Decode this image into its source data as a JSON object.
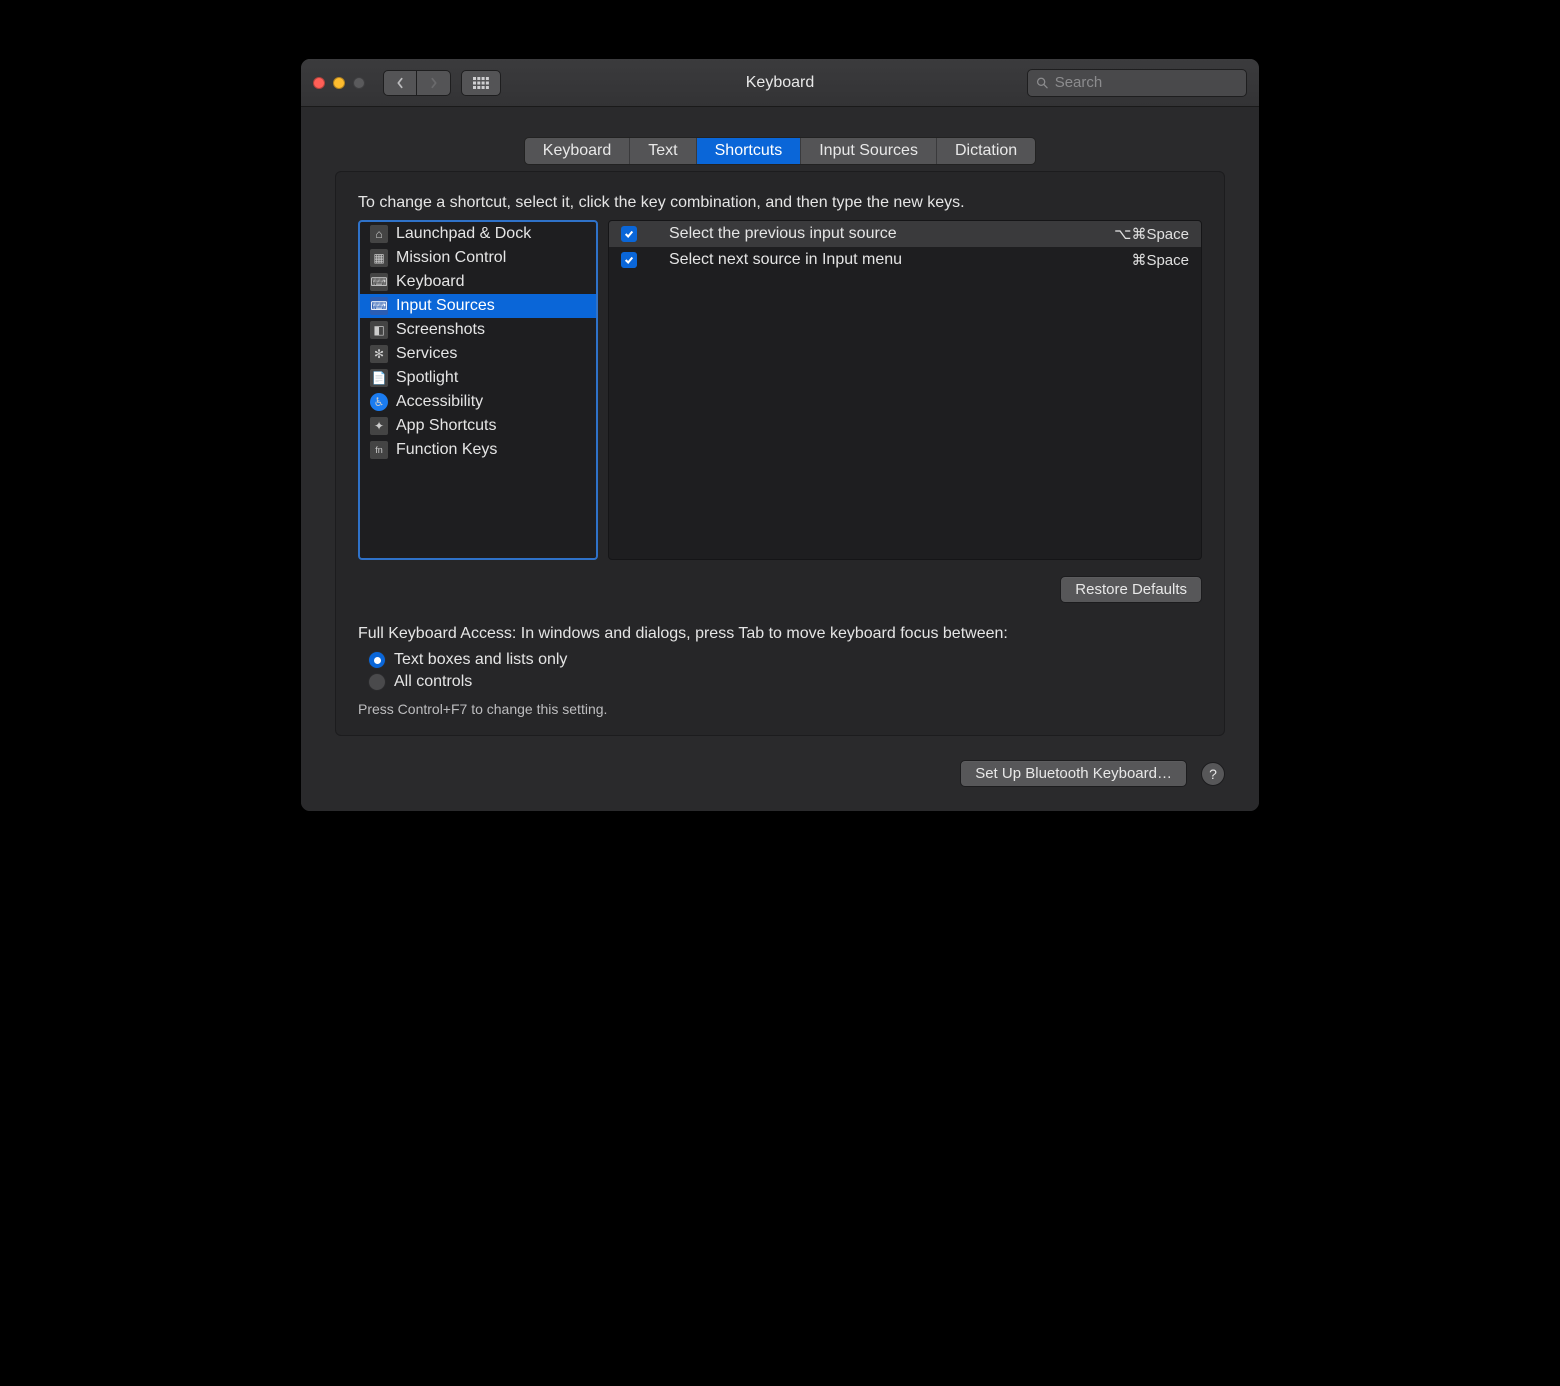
{
  "window": {
    "title": "Keyboard"
  },
  "search": {
    "placeholder": "Search",
    "value": ""
  },
  "tabs": [
    {
      "label": "Keyboard",
      "active": false
    },
    {
      "label": "Text",
      "active": false
    },
    {
      "label": "Shortcuts",
      "active": true
    },
    {
      "label": "Input Sources",
      "active": false
    },
    {
      "label": "Dictation",
      "active": false
    }
  ],
  "instruction": "To change a shortcut, select it, click the key combination, and then type the new keys.",
  "sidebar": {
    "items": [
      {
        "label": "Launchpad & Dock",
        "icon": "launchpad-icon",
        "selected": false
      },
      {
        "label": "Mission Control",
        "icon": "mission-control-icon",
        "selected": false
      },
      {
        "label": "Keyboard",
        "icon": "keyboard-icon",
        "selected": false
      },
      {
        "label": "Input Sources",
        "icon": "input-sources-icon",
        "selected": true
      },
      {
        "label": "Screenshots",
        "icon": "screenshots-icon",
        "selected": false
      },
      {
        "label": "Services",
        "icon": "services-icon",
        "selected": false
      },
      {
        "label": "Spotlight",
        "icon": "spotlight-icon",
        "selected": false
      },
      {
        "label": "Accessibility",
        "icon": "accessibility-icon",
        "selected": false
      },
      {
        "label": "App Shortcuts",
        "icon": "app-shortcuts-icon",
        "selected": false
      },
      {
        "label": "Function Keys",
        "icon": "function-keys-icon",
        "selected": false
      }
    ]
  },
  "shortcuts": [
    {
      "checked": true,
      "label": "Select the previous input source",
      "keys": "⌥⌘Space",
      "selected": true
    },
    {
      "checked": true,
      "label": "Select next source in Input menu",
      "keys": "⌘Space",
      "selected": false
    }
  ],
  "buttons": {
    "restore": "Restore Defaults",
    "bluetooth": "Set Up Bluetooth Keyboard…",
    "help": "?"
  },
  "fka": {
    "label": "Full Keyboard Access: In windows and dialogs, press Tab to move keyboard focus between:",
    "options": [
      {
        "label": "Text boxes and lists only",
        "checked": true
      },
      {
        "label": "All controls",
        "checked": false
      }
    ],
    "hint": "Press Control+F7 to change this setting."
  },
  "icons": {
    "launchpad-icon": "⌂",
    "mission-control-icon": "▦",
    "keyboard-icon": "⌨",
    "input-sources-icon": "⌨",
    "screenshots-icon": "◧",
    "services-icon": "✻",
    "spotlight-icon": "📄",
    "accessibility-icon": "♿︎",
    "app-shortcuts-icon": "✦",
    "function-keys-icon": "fn"
  }
}
